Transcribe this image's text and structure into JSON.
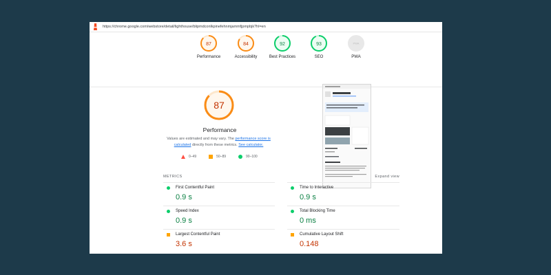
{
  "browser": {
    "url": "https://chrome.google.com/webstore/detail/lighthouse/blipmdconlkpinefehnmjammfjpmpbjk?hl=en"
  },
  "categories": [
    {
      "label": "Performance",
      "score": "87",
      "color": "#fa8c16"
    },
    {
      "label": "Accessibility",
      "score": "84",
      "color": "#fa8c16"
    },
    {
      "label": "Best Practices",
      "score": "92",
      "color": "#0cce6b"
    },
    {
      "label": "SEO",
      "score": "93",
      "color": "#0cce6b"
    },
    {
      "label": "PWA",
      "score": "PWA",
      "color": "#bdbdbd"
    }
  ],
  "hero": {
    "score": "87",
    "title": "Performance",
    "desc_pre": "Values are estimated and may vary. The ",
    "desc_link1": "performance score is calculated",
    "desc_mid": " directly from these metrics. ",
    "desc_link2": "See calculator."
  },
  "legend": [
    {
      "range": "0–49",
      "color": "#ff4e42"
    },
    {
      "range": "50–89",
      "color": "#ffa400"
    },
    {
      "range": "90–100",
      "color": "#0cce6b"
    }
  ],
  "metrics_header": {
    "title": "METRICS",
    "expand": "Expand view"
  },
  "metrics": [
    {
      "name": "First Contentful Paint",
      "value": "0.9 s",
      "status": "good"
    },
    {
      "name": "Time to Interactive",
      "value": "0.9 s",
      "status": "good"
    },
    {
      "name": "Speed Index",
      "value": "0.9 s",
      "status": "good"
    },
    {
      "name": "Total Blocking Time",
      "value": "0 ms",
      "status": "good"
    },
    {
      "name": "Largest Contentful Paint",
      "value": "3.6 s",
      "status": "average"
    },
    {
      "name": "Cumulative Layout Shift",
      "value": "0.148",
      "status": "average"
    }
  ],
  "status_colors": {
    "good": "#0cce6b",
    "average": "#ffa400"
  },
  "value_colors": {
    "good": "#0b8043",
    "average": "#c33300"
  }
}
